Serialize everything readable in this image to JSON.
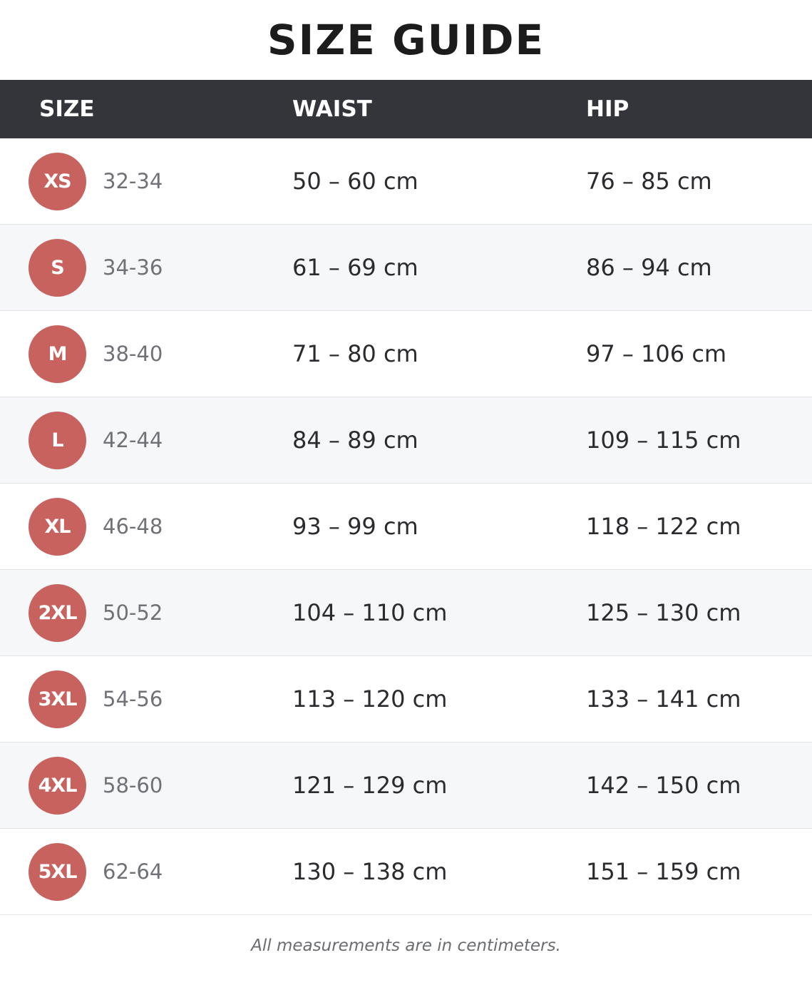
{
  "title": "SIZE GUIDE",
  "columns": {
    "size": "SIZE",
    "waist": "WAIST",
    "hip": "HIP"
  },
  "rows": [
    {
      "size": "XS",
      "eu": "32-34",
      "waist": "50 – 60 cm",
      "hip": "76 – 85 cm"
    },
    {
      "size": "S",
      "eu": "34-36",
      "waist": "61 – 69 cm",
      "hip": "86 – 94 cm"
    },
    {
      "size": "M",
      "eu": "38-40",
      "waist": "71 – 80 cm",
      "hip": "97 – 106 cm"
    },
    {
      "size": "L",
      "eu": "42-44",
      "waist": "84 – 89 cm",
      "hip": "109 – 115 cm"
    },
    {
      "size": "XL",
      "eu": "46-48",
      "waist": "93 – 99 cm",
      "hip": "118 – 122 cm"
    },
    {
      "size": "2XL",
      "eu": "50-52",
      "waist": "104 – 110 cm",
      "hip": "125 – 130 cm"
    },
    {
      "size": "3XL",
      "eu": "54-56",
      "waist": "113 – 120 cm",
      "hip": "133 – 141 cm"
    },
    {
      "size": "4XL",
      "eu": "58-60",
      "waist": "121 – 129 cm",
      "hip": "142 – 150 cm"
    },
    {
      "size": "5XL",
      "eu": "62-64",
      "waist": "130 – 138 cm",
      "hip": "151 – 159 cm"
    }
  ],
  "footnote": "All measurements are in centimeters.",
  "colors": {
    "header_bg": "#33353a",
    "badge": "#c7625f",
    "alt_row": "#f6f7f9"
  }
}
